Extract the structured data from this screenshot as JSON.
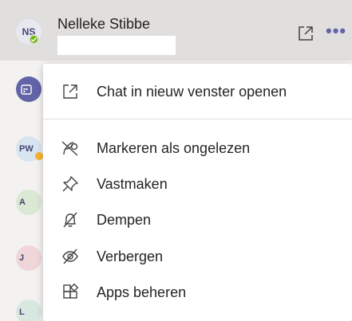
{
  "chat_header": {
    "avatar_initials": "NS",
    "contact_name": "Nelleke Stibbe",
    "status_color": "#6bb700",
    "popout_icon": "popout-icon",
    "more_icon": "more-options-icon",
    "more_glyph": "•••"
  },
  "chat_list": {
    "avatars": [
      {
        "initials": "",
        "icon": "calendar-icon"
      },
      {
        "initials": "PW"
      },
      {
        "initials": "A"
      },
      {
        "initials": "J"
      },
      {
        "initials": "L"
      }
    ]
  },
  "context_menu": {
    "items": [
      {
        "label": "Chat in nieuw venster openen",
        "icon": "popout-icon"
      },
      {
        "label": "Markeren als ongelezen",
        "icon": "mark-unread-icon"
      },
      {
        "label": "Vastmaken",
        "icon": "pin-icon"
      },
      {
        "label": "Dempen",
        "icon": "mute-bell-icon"
      },
      {
        "label": "Verbergen",
        "icon": "hide-icon"
      },
      {
        "label": "Apps beheren",
        "icon": "manage-apps-icon"
      }
    ]
  },
  "colors": {
    "accent": "#6264a7",
    "text": "#252423",
    "icon": "#424242"
  }
}
